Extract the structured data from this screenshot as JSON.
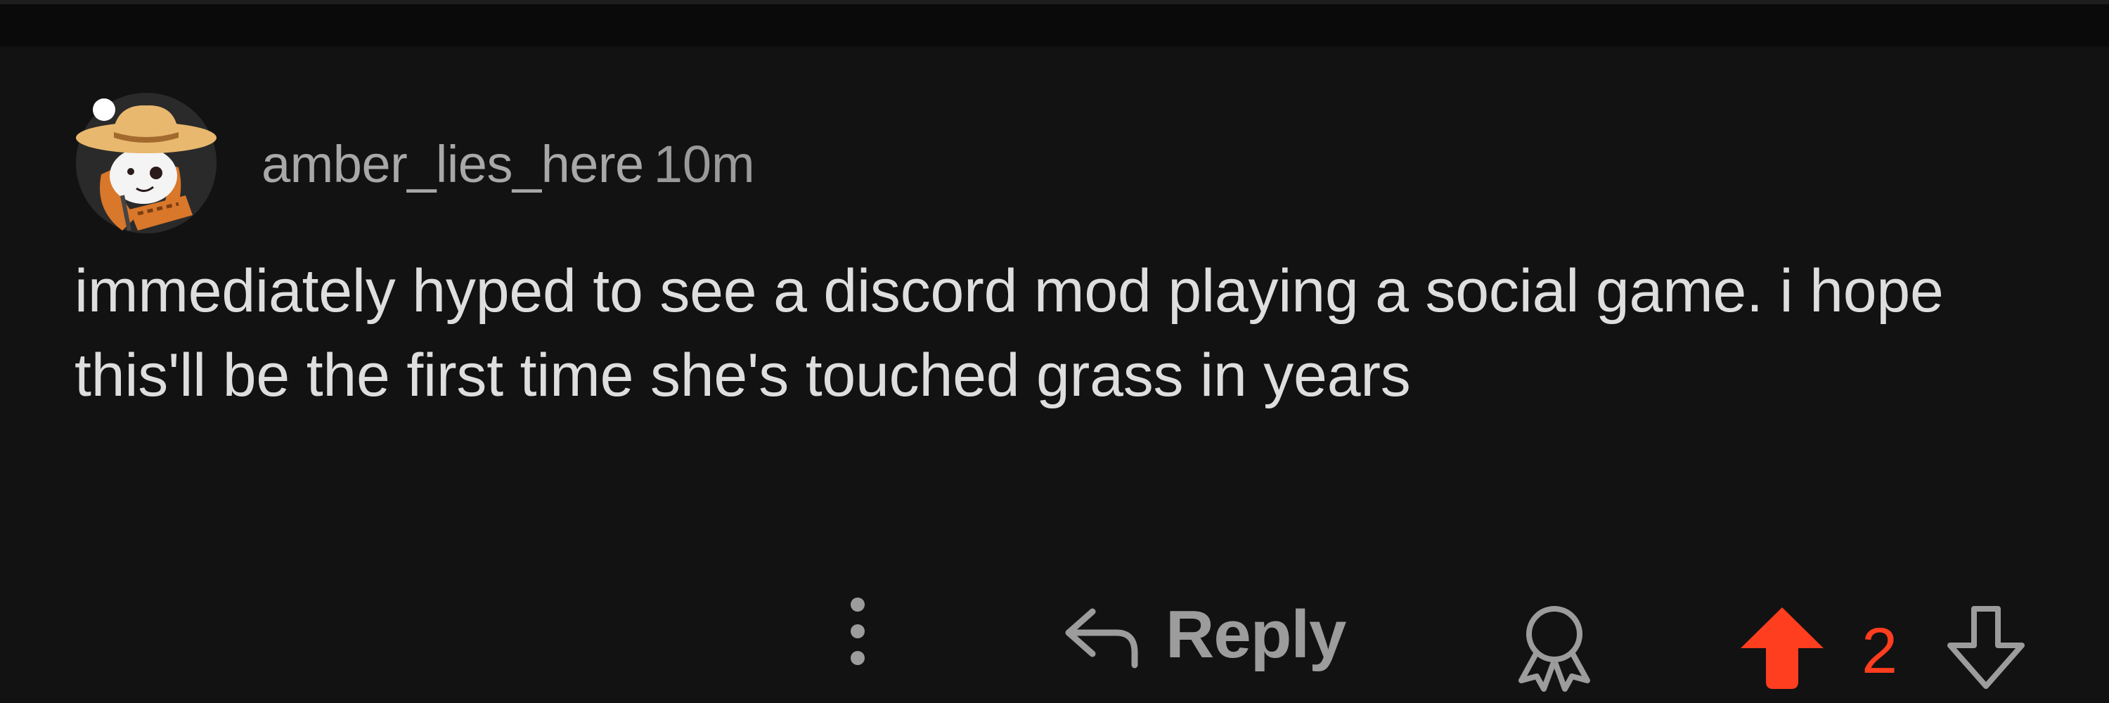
{
  "comment": {
    "author": "amber_lies_here",
    "timestamp": "10m",
    "body": "immediately hyped to see a discord mod playing a social game. i hope this'll be the first time she's touched grass in years",
    "avatar_icon": "snoo-avatar-cowboy-hat"
  },
  "actions": {
    "more_icon": "more-vertical-icon",
    "reply_icon": "reply-arrow-icon",
    "reply_label": "Reply",
    "award_icon": "award-icon",
    "upvote_icon": "upvote-arrow-icon",
    "vote_count": "2",
    "downvote_icon": "downvote-arrow-icon",
    "upvote_active_color": "#ff3d1f"
  },
  "colors": {
    "background": "#121212",
    "text_primary": "#dedede",
    "text_secondary": "#a8a8a8"
  }
}
